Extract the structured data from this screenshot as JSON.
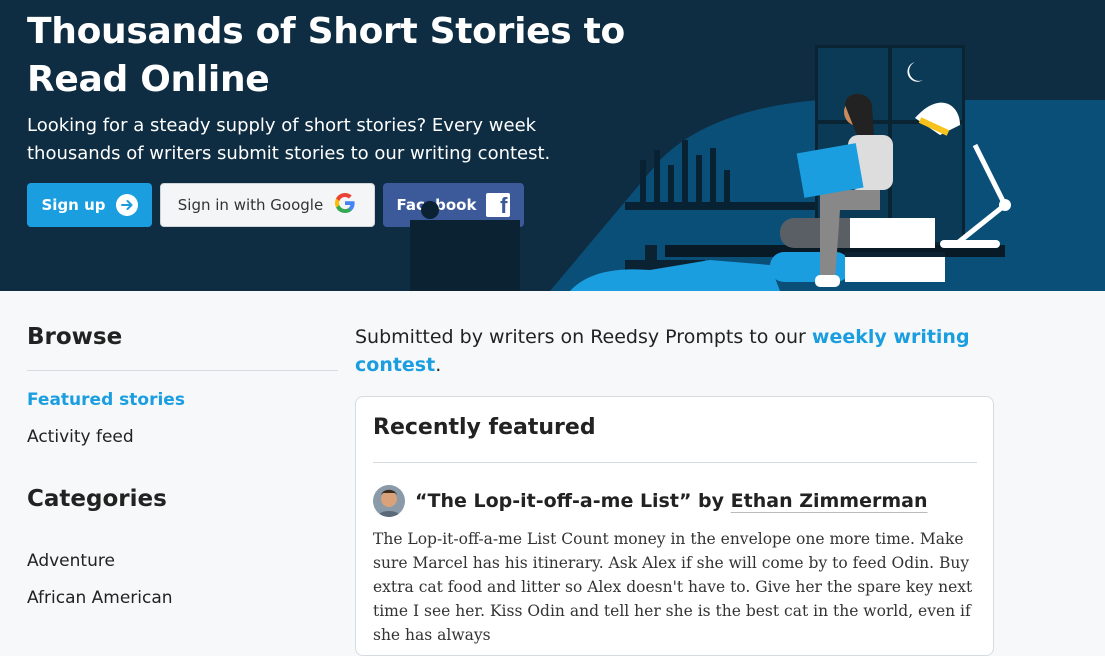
{
  "hero": {
    "title": "Thousands of Short Stories to Read Online",
    "subtitle": "Looking for a steady supply of short stories? Every week thousands of writers submit stories to our writing contest.",
    "buttons": {
      "signup": "Sign up",
      "google": "Sign in with Google",
      "facebook": "Facebook"
    }
  },
  "sidebar": {
    "browse_heading": "Browse",
    "browse_items": [
      "Featured stories",
      "Activity feed"
    ],
    "categories_heading": "Categories",
    "categories": [
      "Adventure",
      "African American"
    ]
  },
  "main": {
    "intro_text": "Submitted by writers on Reedsy Prompts to our ",
    "intro_link": "weekly writing contest",
    "intro_end": ".",
    "card": {
      "title": "Recently featured",
      "story": {
        "title": "“The Lop-it-off-a-me List”",
        "by": " by ",
        "author": "Ethan Zimmerman",
        "excerpt": "The Lop-it-off-a-me List Count money in the envelope one more time. Make sure Marcel has his itinerary. Ask Alex if she will come by to feed Odin. Buy extra cat food and litter so Alex doesn't have to. Give her the spare key next time I see her. Kiss Odin and tell her she is the best cat in the world, even if she has always"
      }
    }
  },
  "colors": {
    "hero_bg": "#0e2d42",
    "accent": "#1a9ee0",
    "facebook": "#3c5a9a"
  }
}
